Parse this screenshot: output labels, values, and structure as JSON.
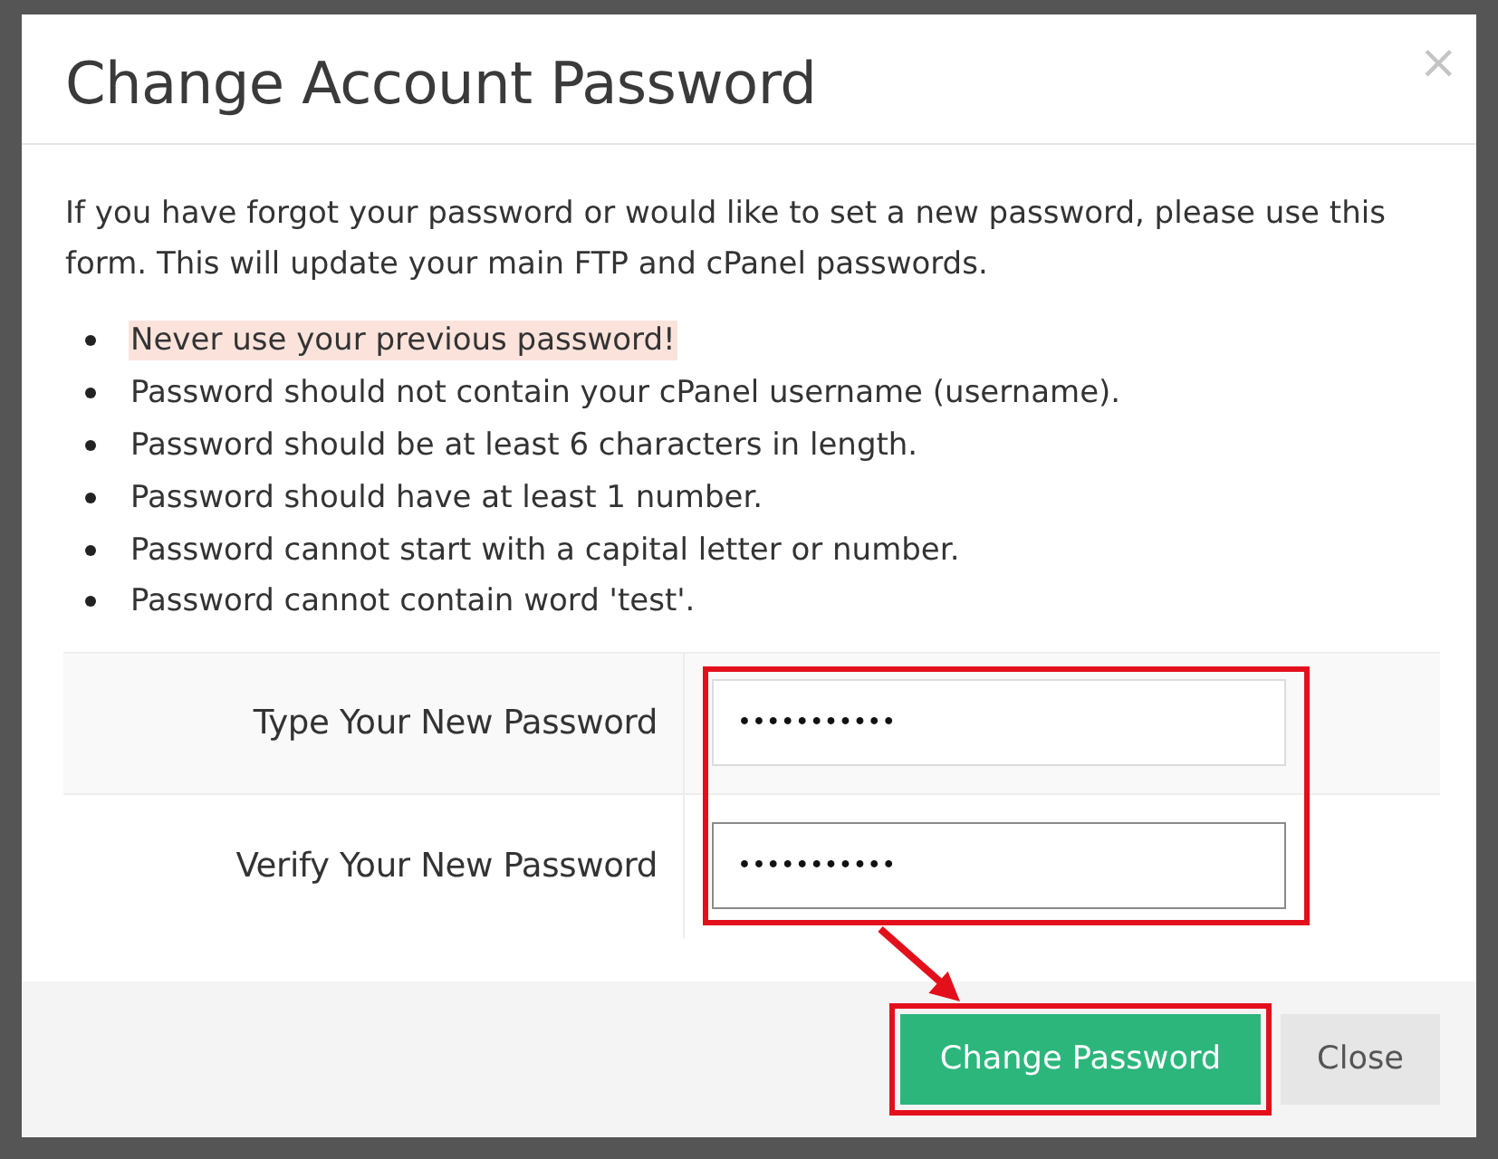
{
  "dialog": {
    "title": "Change Account Password",
    "close_label": "×"
  },
  "intro": "If you have forgot your password or would like to set a new password, please use this form. This will update your main FTP and cPanel passwords.",
  "rules": [
    {
      "text": "Never use your previous password!",
      "highlighted": true
    },
    {
      "text": "Password should not contain your cPanel username (username).",
      "highlighted": false
    },
    {
      "text": "Password should be at least 6 characters in length.",
      "highlighted": false
    },
    {
      "text": "Password should have at least 1 number.",
      "highlighted": false
    },
    {
      "text": "Password cannot start with a capital letter or number.",
      "highlighted": false
    },
    {
      "text": "Password cannot contain word 'test'.",
      "highlighted": false
    }
  ],
  "form": {
    "highlighted": true,
    "fields": [
      {
        "label": "Type Your New Password",
        "value": "•••••••••••",
        "focused": false
      },
      {
        "label": "Verify Your New Password",
        "value": "•••••••••••",
        "focused": true
      }
    ]
  },
  "buttons": [
    {
      "label": "Change Password",
      "kind": "primary",
      "highlighted": true
    },
    {
      "label": "Close",
      "kind": "default",
      "highlighted": false
    }
  ],
  "annotation_arrow": true
}
